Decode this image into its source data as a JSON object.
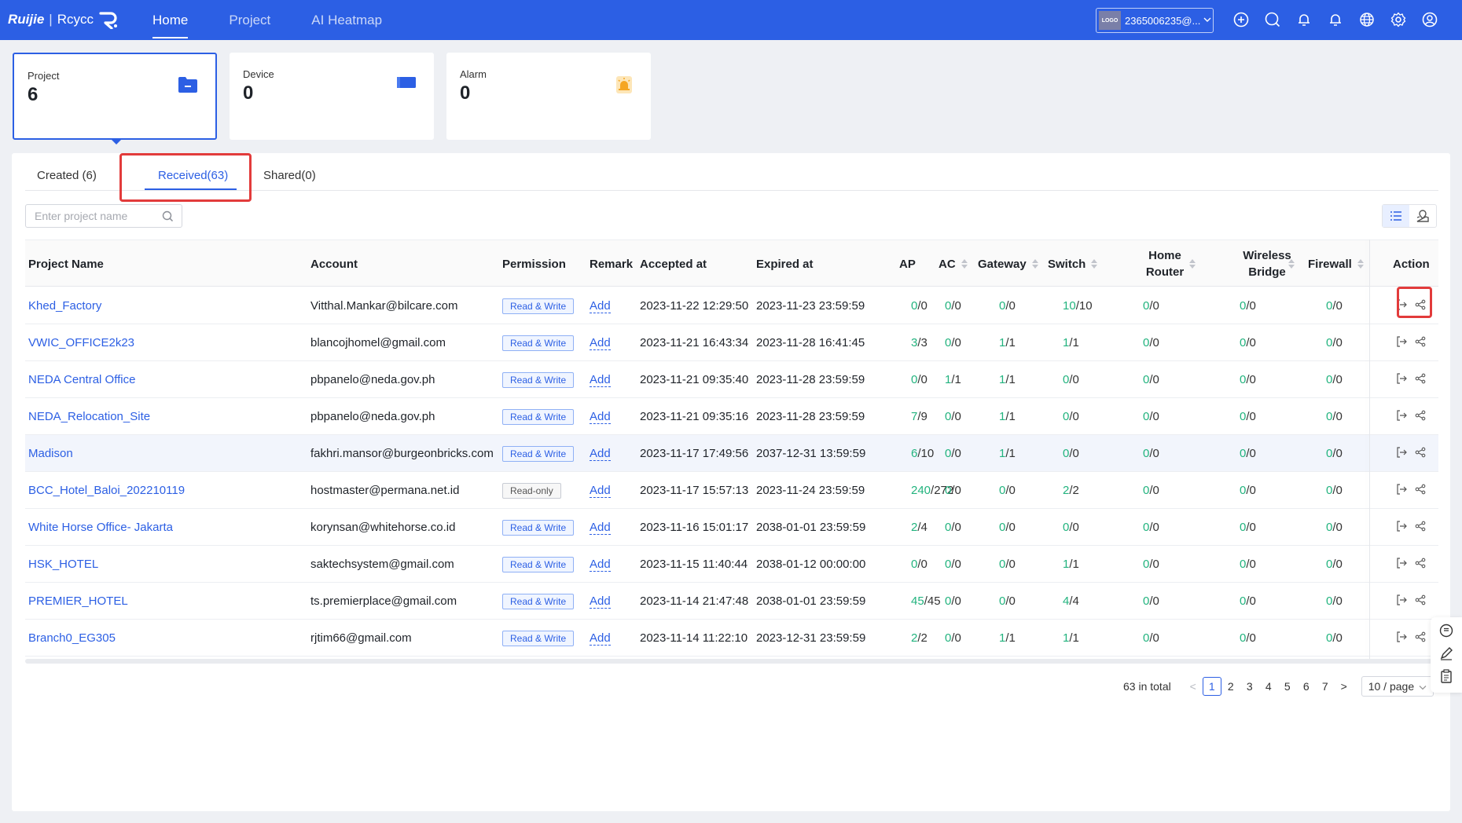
{
  "brand": {
    "name1": "Ruijie",
    "sep": "|",
    "name2": "Rcycc"
  },
  "nav": [
    {
      "label": "Home",
      "active": true
    },
    {
      "label": "Project",
      "active": false
    },
    {
      "label": "AI Heatmap",
      "active": false
    }
  ],
  "account": {
    "logo_text": "LOGO",
    "label": "2365006235@..."
  },
  "top_icons": [
    "add-circle-icon",
    "search-icon",
    "bell-icon",
    "notification-icon",
    "globe-icon",
    "settings-icon",
    "user-icon"
  ],
  "cards": [
    {
      "label": "Project",
      "value": "6",
      "icon": "folder-icon",
      "selected": true
    },
    {
      "label": "Device",
      "value": "0",
      "icon": "device-icon",
      "selected": false
    },
    {
      "label": "Alarm",
      "value": "0",
      "icon": "alarm-icon",
      "selected": false
    }
  ],
  "tabs": [
    {
      "label": "Created (6)",
      "active": false
    },
    {
      "label": "Received(63)",
      "active": true
    },
    {
      "label": "Shared(0)",
      "active": false
    }
  ],
  "search": {
    "placeholder": "Enter project name",
    "value": ""
  },
  "table": {
    "headers": {
      "project_name": "Project Name",
      "account": "Account",
      "permission": "Permission",
      "remark": "Remark",
      "accepted_at": "Accepted at",
      "expired_at": "Expired at",
      "ap": "AP",
      "ac": "AC",
      "gateway": "Gateway",
      "switch": "Switch",
      "home_router_1": "Home",
      "home_router_2": "Router",
      "wireless_bridge_1": "Wireless",
      "wireless_bridge_2": "Bridge",
      "firewall": "Firewall",
      "action": "Action"
    },
    "rows": [
      {
        "name": "Khed_Factory",
        "account": "Vitthal.Mankar@bilcare.com",
        "permission": "Read & Write",
        "remark": "Add",
        "accepted": "2023-11-22 12:29:50",
        "expired": "2023-11-23 23:59:59",
        "ap": [
          "0",
          "/0"
        ],
        "ac": [
          "0",
          "/0"
        ],
        "gw": [
          "0",
          "/0"
        ],
        "sw": [
          "10",
          "/10"
        ],
        "hr": [
          "0",
          "/0"
        ],
        "wb": [
          "0",
          "/0"
        ],
        "fw": [
          "0",
          "/0"
        ]
      },
      {
        "name": "VWIC_OFFICE2k23",
        "account": "blancojhomel@gmail.com",
        "permission": "Read & Write",
        "remark": "Add",
        "accepted": "2023-11-21 16:43:34",
        "expired": "2023-11-28 16:41:45",
        "ap": [
          "3",
          "/3"
        ],
        "ac": [
          "0",
          "/0"
        ],
        "gw": [
          "1",
          "/1"
        ],
        "sw": [
          "1",
          "/1"
        ],
        "hr": [
          "0",
          "/0"
        ],
        "wb": [
          "0",
          "/0"
        ],
        "fw": [
          "0",
          "/0"
        ]
      },
      {
        "name": "NEDA Central Office",
        "account": "pbpanelo@neda.gov.ph",
        "permission": "Read & Write",
        "remark": "Add",
        "accepted": "2023-11-21 09:35:40",
        "expired": "2023-11-28 23:59:59",
        "ap": [
          "0",
          "/0"
        ],
        "ac": [
          "1",
          "/1"
        ],
        "gw": [
          "1",
          "/1"
        ],
        "sw": [
          "0",
          "/0"
        ],
        "hr": [
          "0",
          "/0"
        ],
        "wb": [
          "0",
          "/0"
        ],
        "fw": [
          "0",
          "/0"
        ]
      },
      {
        "name": "NEDA_Relocation_Site",
        "account": "pbpanelo@neda.gov.ph",
        "permission": "Read & Write",
        "remark": "Add",
        "accepted": "2023-11-21 09:35:16",
        "expired": "2023-11-28 23:59:59",
        "ap": [
          "7",
          "/9"
        ],
        "ac": [
          "0",
          "/0"
        ],
        "gw": [
          "1",
          "/1"
        ],
        "sw": [
          "0",
          "/0"
        ],
        "hr": [
          "0",
          "/0"
        ],
        "wb": [
          "0",
          "/0"
        ],
        "fw": [
          "0",
          "/0"
        ]
      },
      {
        "name": "Madison",
        "account": "fakhri.mansor@burgeonbricks.com",
        "permission": "Read & Write",
        "remark": "Add",
        "accepted": "2023-11-17 17:49:56",
        "expired": "2037-12-31 13:59:59",
        "ap": [
          "6",
          "/10"
        ],
        "ac": [
          "0",
          "/0"
        ],
        "gw": [
          "1",
          "/1"
        ],
        "sw": [
          "0",
          "/0"
        ],
        "hr": [
          "0",
          "/0"
        ],
        "wb": [
          "0",
          "/0"
        ],
        "fw": [
          "0",
          "/0"
        ]
      },
      {
        "name": "BCC_Hotel_Baloi_202210119",
        "account": "hostmaster@permana.net.id",
        "permission": "Read-only",
        "remark": "Add",
        "accepted": "2023-11-17 15:57:13",
        "expired": "2023-11-24 23:59:59",
        "ap": [
          "240",
          "/272"
        ],
        "ac": [
          "0",
          "/0"
        ],
        "gw": [
          "0",
          "/0"
        ],
        "sw": [
          "2",
          "/2"
        ],
        "hr": [
          "0",
          "/0"
        ],
        "wb": [
          "0",
          "/0"
        ],
        "fw": [
          "0",
          "/0"
        ]
      },
      {
        "name": "White Horse Office- Jakarta",
        "account": "korynsan@whitehorse.co.id",
        "permission": "Read & Write",
        "remark": "Add",
        "accepted": "2023-11-16 15:01:17",
        "expired": "2038-01-01 23:59:59",
        "ap": [
          "2",
          "/4"
        ],
        "ac": [
          "0",
          "/0"
        ],
        "gw": [
          "0",
          "/0"
        ],
        "sw": [
          "0",
          "/0"
        ],
        "hr": [
          "0",
          "/0"
        ],
        "wb": [
          "0",
          "/0"
        ],
        "fw": [
          "0",
          "/0"
        ]
      },
      {
        "name": "HSK_HOTEL",
        "account": "saktechsystem@gmail.com",
        "permission": "Read & Write",
        "remark": "Add",
        "accepted": "2023-11-15 11:40:44",
        "expired": "2038-01-12 00:00:00",
        "ap": [
          "0",
          "/0"
        ],
        "ac": [
          "0",
          "/0"
        ],
        "gw": [
          "0",
          "/0"
        ],
        "sw": [
          "1",
          "/1"
        ],
        "hr": [
          "0",
          "/0"
        ],
        "wb": [
          "0",
          "/0"
        ],
        "fw": [
          "0",
          "/0"
        ]
      },
      {
        "name": "PREMIER_HOTEL",
        "account": "ts.premierplace@gmail.com",
        "permission": "Read & Write",
        "remark": "Add",
        "accepted": "2023-11-14 21:47:48",
        "expired": "2038-01-01 23:59:59",
        "ap": [
          "45",
          "/45"
        ],
        "ac": [
          "0",
          "/0"
        ],
        "gw": [
          "0",
          "/0"
        ],
        "sw": [
          "4",
          "/4"
        ],
        "hr": [
          "0",
          "/0"
        ],
        "wb": [
          "0",
          "/0"
        ],
        "fw": [
          "0",
          "/0"
        ]
      },
      {
        "name": "Branch0_EG305",
        "account": "rjtim66@gmail.com",
        "permission": "Read & Write",
        "remark": "Add",
        "accepted": "2023-11-14 11:22:10",
        "expired": "2023-12-31 23:59:59",
        "ap": [
          "2",
          "/2"
        ],
        "ac": [
          "0",
          "/0"
        ],
        "gw": [
          "1",
          "/1"
        ],
        "sw": [
          "1",
          "/1"
        ],
        "hr": [
          "0",
          "/0"
        ],
        "wb": [
          "0",
          "/0"
        ],
        "fw": [
          "0",
          "/0"
        ]
      }
    ]
  },
  "pagination": {
    "total": "63 in total",
    "prev": "<",
    "pages": [
      "1",
      "2",
      "3",
      "4",
      "5",
      "6",
      "7"
    ],
    "current": "1",
    "next": ">",
    "page_size": "10 / page"
  },
  "colors": {
    "primary": "#2c5fe4",
    "online": "#22b37e",
    "highlight": "#e23b3b"
  }
}
